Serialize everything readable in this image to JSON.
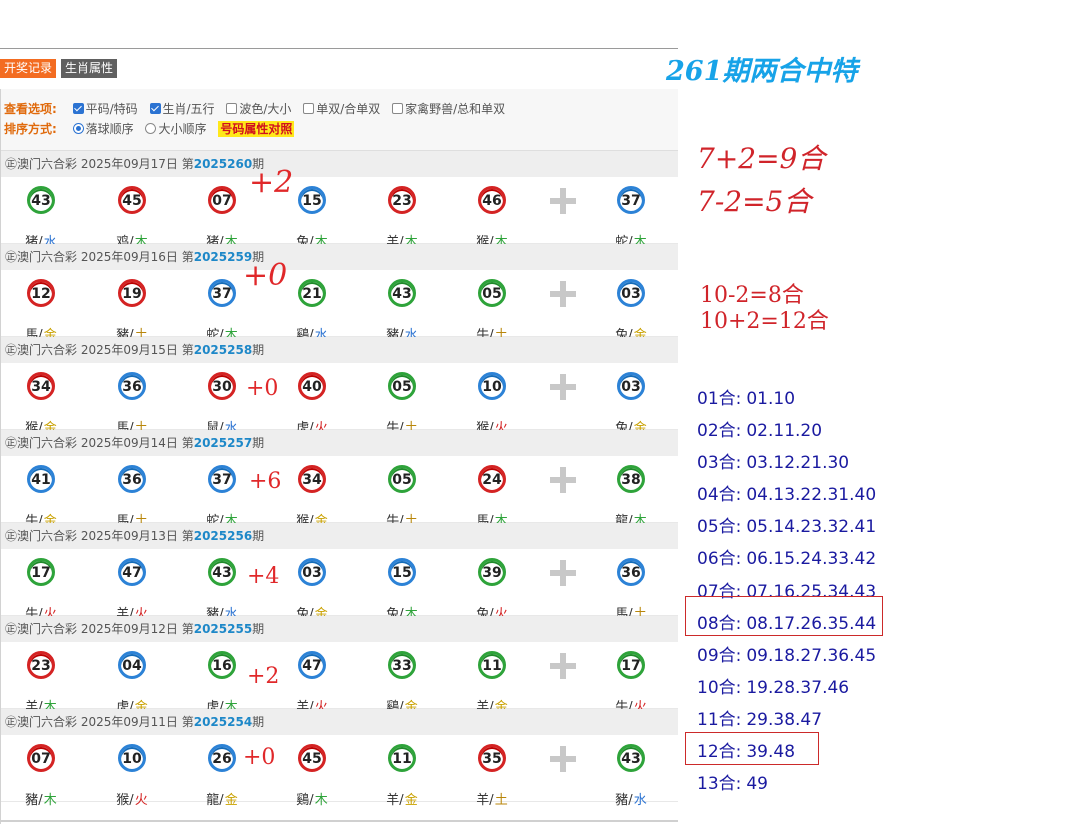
{
  "tabs": [
    "开奖记录",
    "生肖属性"
  ],
  "options": {
    "view_label": "查看选项:",
    "view_items": [
      {
        "label": "平码/特码",
        "checked": true
      },
      {
        "label": "生肖/五行",
        "checked": true
      },
      {
        "label": "波色/大小",
        "checked": false
      },
      {
        "label": "单双/合单双",
        "checked": false
      },
      {
        "label": "家禽野兽/总和单双",
        "checked": false
      }
    ],
    "sort_label": "排序方式:",
    "sort_items": [
      {
        "label": "落球顺序",
        "checked": true
      },
      {
        "label": "大小顺序",
        "checked": false
      }
    ],
    "compare_label": "号码属性对照"
  },
  "draws": [
    {
      "header_pre": "㊣澳门六合彩 2025年09月17日 第",
      "period": "2025260",
      "suffix": "期",
      "note": "+2",
      "balls": [
        {
          "n": "43",
          "c": "green",
          "z": "猪",
          "e": "水"
        },
        {
          "n": "45",
          "c": "red",
          "z": "鸡",
          "e": "木"
        },
        {
          "n": "07",
          "c": "red",
          "z": "猪",
          "e": "木"
        },
        {
          "n": "15",
          "c": "blue",
          "z": "兔",
          "e": "木"
        },
        {
          "n": "23",
          "c": "red",
          "z": "羊",
          "e": "木"
        },
        {
          "n": "46",
          "c": "red",
          "z": "猴",
          "e": "木"
        },
        {
          "n": "37",
          "c": "blue",
          "z": "蛇",
          "e": "木"
        }
      ]
    },
    {
      "header_pre": "㊣澳门六合彩 2025年09月16日 第",
      "period": "2025259",
      "suffix": "期",
      "note": "+0",
      "balls": [
        {
          "n": "12",
          "c": "red",
          "z": "馬",
          "e": "金"
        },
        {
          "n": "19",
          "c": "red",
          "z": "豬",
          "e": "土"
        },
        {
          "n": "37",
          "c": "blue",
          "z": "蛇",
          "e": "木"
        },
        {
          "n": "21",
          "c": "green",
          "z": "鷄",
          "e": "水"
        },
        {
          "n": "43",
          "c": "green",
          "z": "豬",
          "e": "水"
        },
        {
          "n": "05",
          "c": "green",
          "z": "牛",
          "e": "土"
        },
        {
          "n": "03",
          "c": "blue",
          "z": "兔",
          "e": "金"
        }
      ]
    },
    {
      "header_pre": "㊣澳门六合彩 2025年09月15日 第",
      "period": "2025258",
      "suffix": "期",
      "note": "+0",
      "balls": [
        {
          "n": "34",
          "c": "red",
          "z": "猴",
          "e": "金"
        },
        {
          "n": "36",
          "c": "blue",
          "z": "馬",
          "e": "土"
        },
        {
          "n": "30",
          "c": "red",
          "z": "鼠",
          "e": "水"
        },
        {
          "n": "40",
          "c": "red",
          "z": "虎",
          "e": "火"
        },
        {
          "n": "05",
          "c": "green",
          "z": "牛",
          "e": "土"
        },
        {
          "n": "10",
          "c": "blue",
          "z": "猴",
          "e": "火"
        },
        {
          "n": "03",
          "c": "blue",
          "z": "兔",
          "e": "金"
        }
      ]
    },
    {
      "header_pre": "㊣澳门六合彩 2025年09月14日 第",
      "period": "2025257",
      "suffix": "期",
      "note": "+6",
      "balls": [
        {
          "n": "41",
          "c": "blue",
          "z": "牛",
          "e": "金"
        },
        {
          "n": "36",
          "c": "blue",
          "z": "馬",
          "e": "土"
        },
        {
          "n": "37",
          "c": "blue",
          "z": "蛇",
          "e": "木"
        },
        {
          "n": "34",
          "c": "red",
          "z": "猴",
          "e": "金"
        },
        {
          "n": "05",
          "c": "green",
          "z": "牛",
          "e": "土"
        },
        {
          "n": "24",
          "c": "red",
          "z": "馬",
          "e": "木"
        },
        {
          "n": "38",
          "c": "green",
          "z": "龍",
          "e": "木"
        }
      ]
    },
    {
      "header_pre": "㊣澳门六合彩 2025年09月13日 第",
      "period": "2025256",
      "suffix": "期",
      "note": "+4",
      "balls": [
        {
          "n": "17",
          "c": "green",
          "z": "牛",
          "e": "火"
        },
        {
          "n": "47",
          "c": "blue",
          "z": "羊",
          "e": "火"
        },
        {
          "n": "43",
          "c": "green",
          "z": "豬",
          "e": "水"
        },
        {
          "n": "03",
          "c": "blue",
          "z": "兔",
          "e": "金"
        },
        {
          "n": "15",
          "c": "blue",
          "z": "兔",
          "e": "木"
        },
        {
          "n": "39",
          "c": "green",
          "z": "兔",
          "e": "火"
        },
        {
          "n": "36",
          "c": "blue",
          "z": "馬",
          "e": "土"
        }
      ]
    },
    {
      "header_pre": "㊣澳门六合彩 2025年09月12日 第",
      "period": "2025255",
      "suffix": "期",
      "note": "+2",
      "balls": [
        {
          "n": "23",
          "c": "red",
          "z": "羊",
          "e": "木"
        },
        {
          "n": "04",
          "c": "blue",
          "z": "虎",
          "e": "金"
        },
        {
          "n": "16",
          "c": "green",
          "z": "虎",
          "e": "木"
        },
        {
          "n": "47",
          "c": "blue",
          "z": "羊",
          "e": "火"
        },
        {
          "n": "33",
          "c": "green",
          "z": "鷄",
          "e": "金"
        },
        {
          "n": "11",
          "c": "green",
          "z": "羊",
          "e": "金"
        },
        {
          "n": "17",
          "c": "green",
          "z": "牛",
          "e": "火"
        }
      ]
    },
    {
      "header_pre": "㊣澳门六合彩 2025年09月11日 第",
      "period": "2025254",
      "suffix": "期",
      "note": "+0",
      "balls": [
        {
          "n": "07",
          "c": "red",
          "z": "豬",
          "e": "木"
        },
        {
          "n": "10",
          "c": "blue",
          "z": "猴",
          "e": "火"
        },
        {
          "n": "26",
          "c": "blue",
          "z": "龍",
          "e": "金"
        },
        {
          "n": "45",
          "c": "red",
          "z": "鷄",
          "e": "木"
        },
        {
          "n": "11",
          "c": "green",
          "z": "羊",
          "e": "金"
        },
        {
          "n": "35",
          "c": "red",
          "z": "羊",
          "e": "土"
        },
        {
          "n": "43",
          "c": "green",
          "z": "豬",
          "e": "水"
        }
      ]
    }
  ],
  "right": {
    "title": "261期两合中特",
    "formulas": [
      "7+2=9合",
      "7-2=5合",
      "10-2=8合",
      "10+2=12合"
    ],
    "he_list": [
      {
        "k": "01合:",
        "v": "01.10"
      },
      {
        "k": "02合:",
        "v": "02.11.20"
      },
      {
        "k": "03合:",
        "v": "03.12.21.30"
      },
      {
        "k": "04合:",
        "v": "04.13.22.31.40"
      },
      {
        "k": "05合:",
        "v": "05.14.23.32.41"
      },
      {
        "k": "06合:",
        "v": "06.15.24.33.42"
      },
      {
        "k": "07合:",
        "v": "07.16.25.34.43"
      },
      {
        "k": "08合:",
        "v": "08.17.26.35.44"
      },
      {
        "k": "09合:",
        "v": "09.18.27.36.45"
      },
      {
        "k": "10合:",
        "v": "19.28.37.46"
      },
      {
        "k": "11合:",
        "v": "29.38.47"
      },
      {
        "k": "12合:",
        "v": "39.48"
      },
      {
        "k": "13合:",
        "v": "49"
      }
    ]
  }
}
